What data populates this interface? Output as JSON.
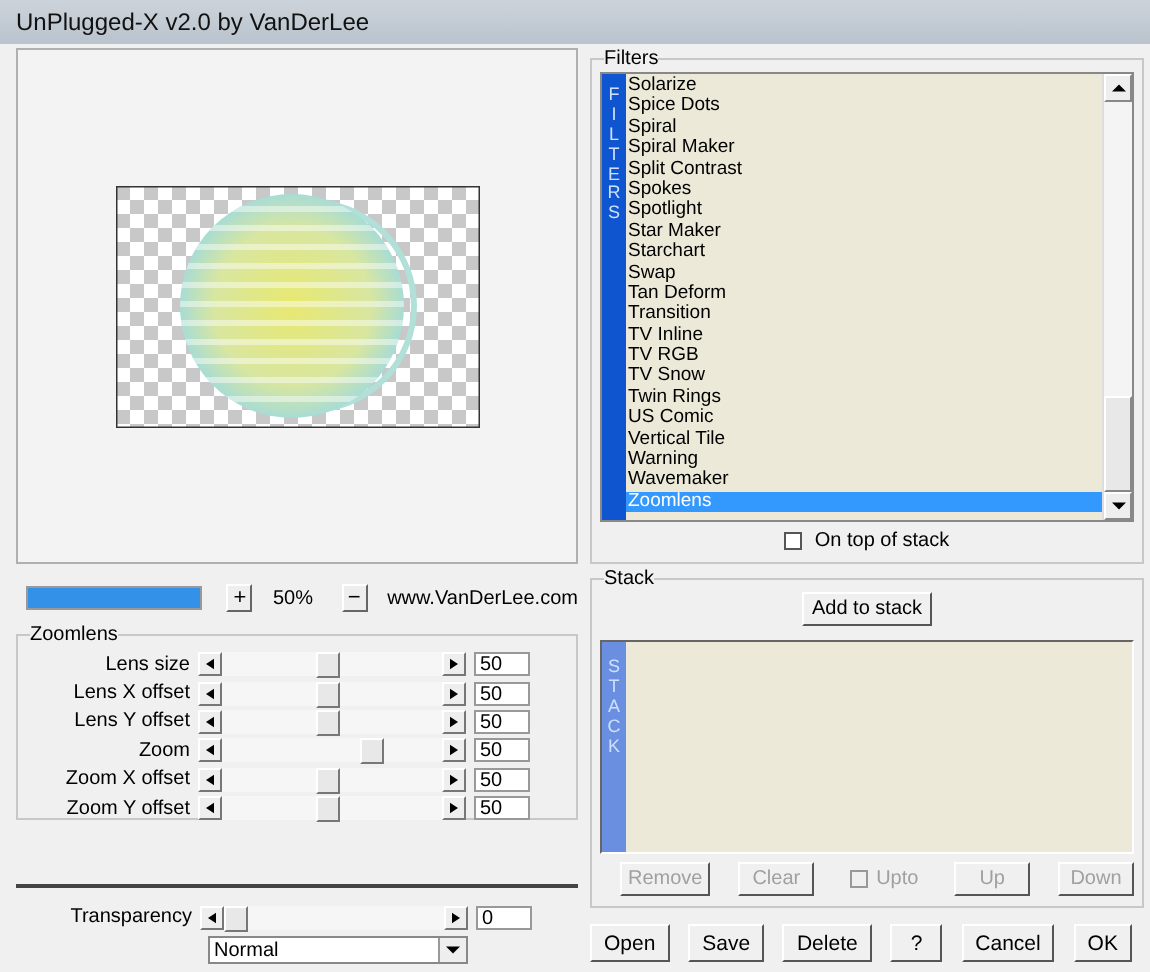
{
  "window": {
    "title": "UnPlugged-X v2.0 by VanDerLee"
  },
  "zoom_bar": {
    "level": 1,
    "plus": "+",
    "percent": "50%",
    "minus": "−",
    "link": "www.VanDerLee.com"
  },
  "zoomlens": {
    "title": "Zoomlens",
    "sliders": [
      {
        "label": "Lens size",
        "value": "50"
      },
      {
        "label": "Lens X offset",
        "value": "50"
      },
      {
        "label": "Lens Y offset",
        "value": "50"
      },
      {
        "label": "Zoom",
        "value": "50"
      },
      {
        "label": "Zoom X offset",
        "value": "50"
      },
      {
        "label": "Zoom Y offset",
        "value": "50"
      }
    ]
  },
  "transparency": {
    "label": "Transparency",
    "level": 0,
    "value": "0"
  },
  "blend_mode": {
    "value": "Normal"
  },
  "filters": {
    "title": "Filters",
    "strip": "FILTERS",
    "items": [
      {
        "label": "Solarize",
        "selected": false
      },
      {
        "label": "Spice Dots",
        "selected": false
      },
      {
        "label": "Spiral",
        "selected": false
      },
      {
        "label": "Spiral Maker",
        "selected": false
      },
      {
        "label": "Split Contrast",
        "selected": false
      },
      {
        "label": "Spokes",
        "selected": false
      },
      {
        "label": "Spotlight",
        "selected": false
      },
      {
        "label": "Star Maker",
        "selected": false
      },
      {
        "label": "Starchart",
        "selected": false
      },
      {
        "label": "Swap",
        "selected": false
      },
      {
        "label": "Tan Deform",
        "selected": false
      },
      {
        "label": "Transition",
        "selected": false
      },
      {
        "label": "TV Inline",
        "selected": false
      },
      {
        "label": "TV RGB",
        "selected": false
      },
      {
        "label": "TV Snow",
        "selected": false
      },
      {
        "label": "Twin Rings",
        "selected": false
      },
      {
        "label": "US Comic",
        "selected": false
      },
      {
        "label": "Vertical Tile",
        "selected": false
      },
      {
        "label": "Warning",
        "selected": false
      },
      {
        "label": "Wavemaker",
        "selected": false
      },
      {
        "label": "Zoomlens",
        "selected": true
      }
    ],
    "on_top": {
      "label": "On top of stack",
      "checked": false
    }
  },
  "stack": {
    "title": "Stack",
    "add": "Add to stack",
    "strip": "STACK",
    "buttons": [
      {
        "kind": "button",
        "label": "Remove",
        "disabled": true
      },
      {
        "kind": "button",
        "label": "Clear",
        "disabled": true
      },
      {
        "kind": "checkbox",
        "label": "Upto",
        "checked": false,
        "disabled": true
      },
      {
        "kind": "button",
        "label": "Up",
        "disabled": true
      },
      {
        "kind": "button",
        "label": "Down",
        "disabled": true
      }
    ]
  },
  "buttons": [
    "Open",
    "Save",
    "Delete",
    "?",
    "Cancel",
    "OK"
  ]
}
